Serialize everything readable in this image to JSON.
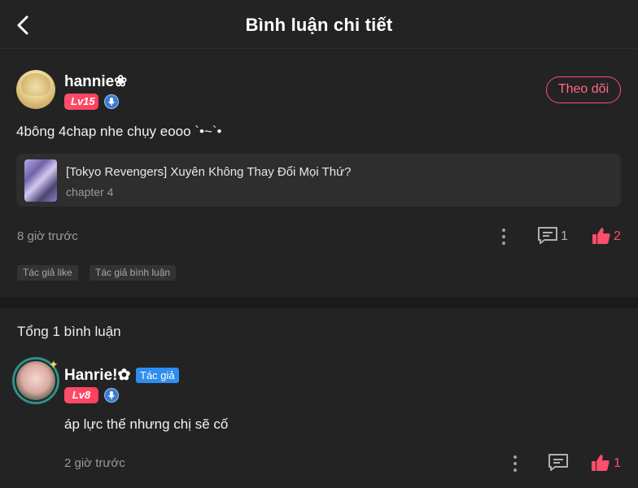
{
  "header": {
    "title": "Bình luận chi tiết",
    "back_icon": "chevron-left-icon"
  },
  "main_comment": {
    "username": "hannie❀",
    "level": "Lv15",
    "follow_label": "Theo dõi",
    "text": "4bông 4chap nhe chụy eooo `•~`•",
    "manga": {
      "title": "[Tokyo Revengers] Xuyên Không Thay Đổi Mọi Thứ?",
      "chapter": "chapter 4"
    },
    "time": "8 giờ trước",
    "reply_count": "1",
    "like_count": "2",
    "tags": [
      "Tác giả like",
      "Tác giả bình luận"
    ]
  },
  "replies_section": {
    "total_label": "Tổng 1 bình luận"
  },
  "reply": {
    "username": "Hanrie!✿",
    "author_tag": "Tác giả",
    "level": "Lv8",
    "text": "áp lực thế nhưng chị sẽ cố",
    "time": "2 giờ trước",
    "like_count": "1"
  },
  "colors": {
    "background": "#232323",
    "accent": "#ff4d6d",
    "level_badge": "#ff3e5c",
    "author_tag": "#2e8df0",
    "muted_text": "#9a9a9a"
  }
}
